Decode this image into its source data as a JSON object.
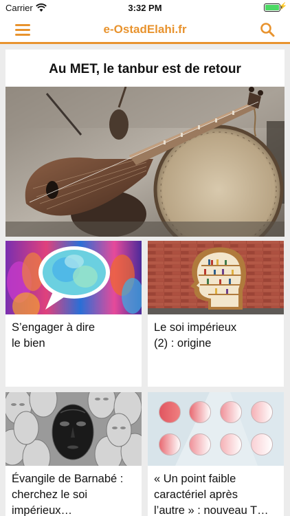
{
  "status": {
    "carrier": "Carrier",
    "time": "3:32 PM",
    "battery_level": 1.0
  },
  "navbar": {
    "title": "e-OstadElahi.fr",
    "menu_icon": "hamburger-menu-icon",
    "search_icon": "search-icon"
  },
  "featured": {
    "title": "Au MET, le tanbur est de retour",
    "image": "tanbur-and-frame-drum-photo"
  },
  "articles": [
    {
      "title": "S’engager à dire\nle bien",
      "image": "speech-bubble-faces-illustration"
    },
    {
      "title": "Le soi impérieux\n(2) : origine",
      "image": "head-bookshelf-brick-wall"
    },
    {
      "title": "Évangile de Barnabé :\ncherchez le soi\nimpérieux…",
      "image": "masks-black-and-white"
    },
    {
      "title": "« Un point faible\ncaractériel après\nl’autre » : nouveau T…",
      "image": "red-gradient-circles-grid"
    }
  ],
  "colors": {
    "accent": "#e8932e",
    "background": "#ececec",
    "card": "#ffffff"
  }
}
